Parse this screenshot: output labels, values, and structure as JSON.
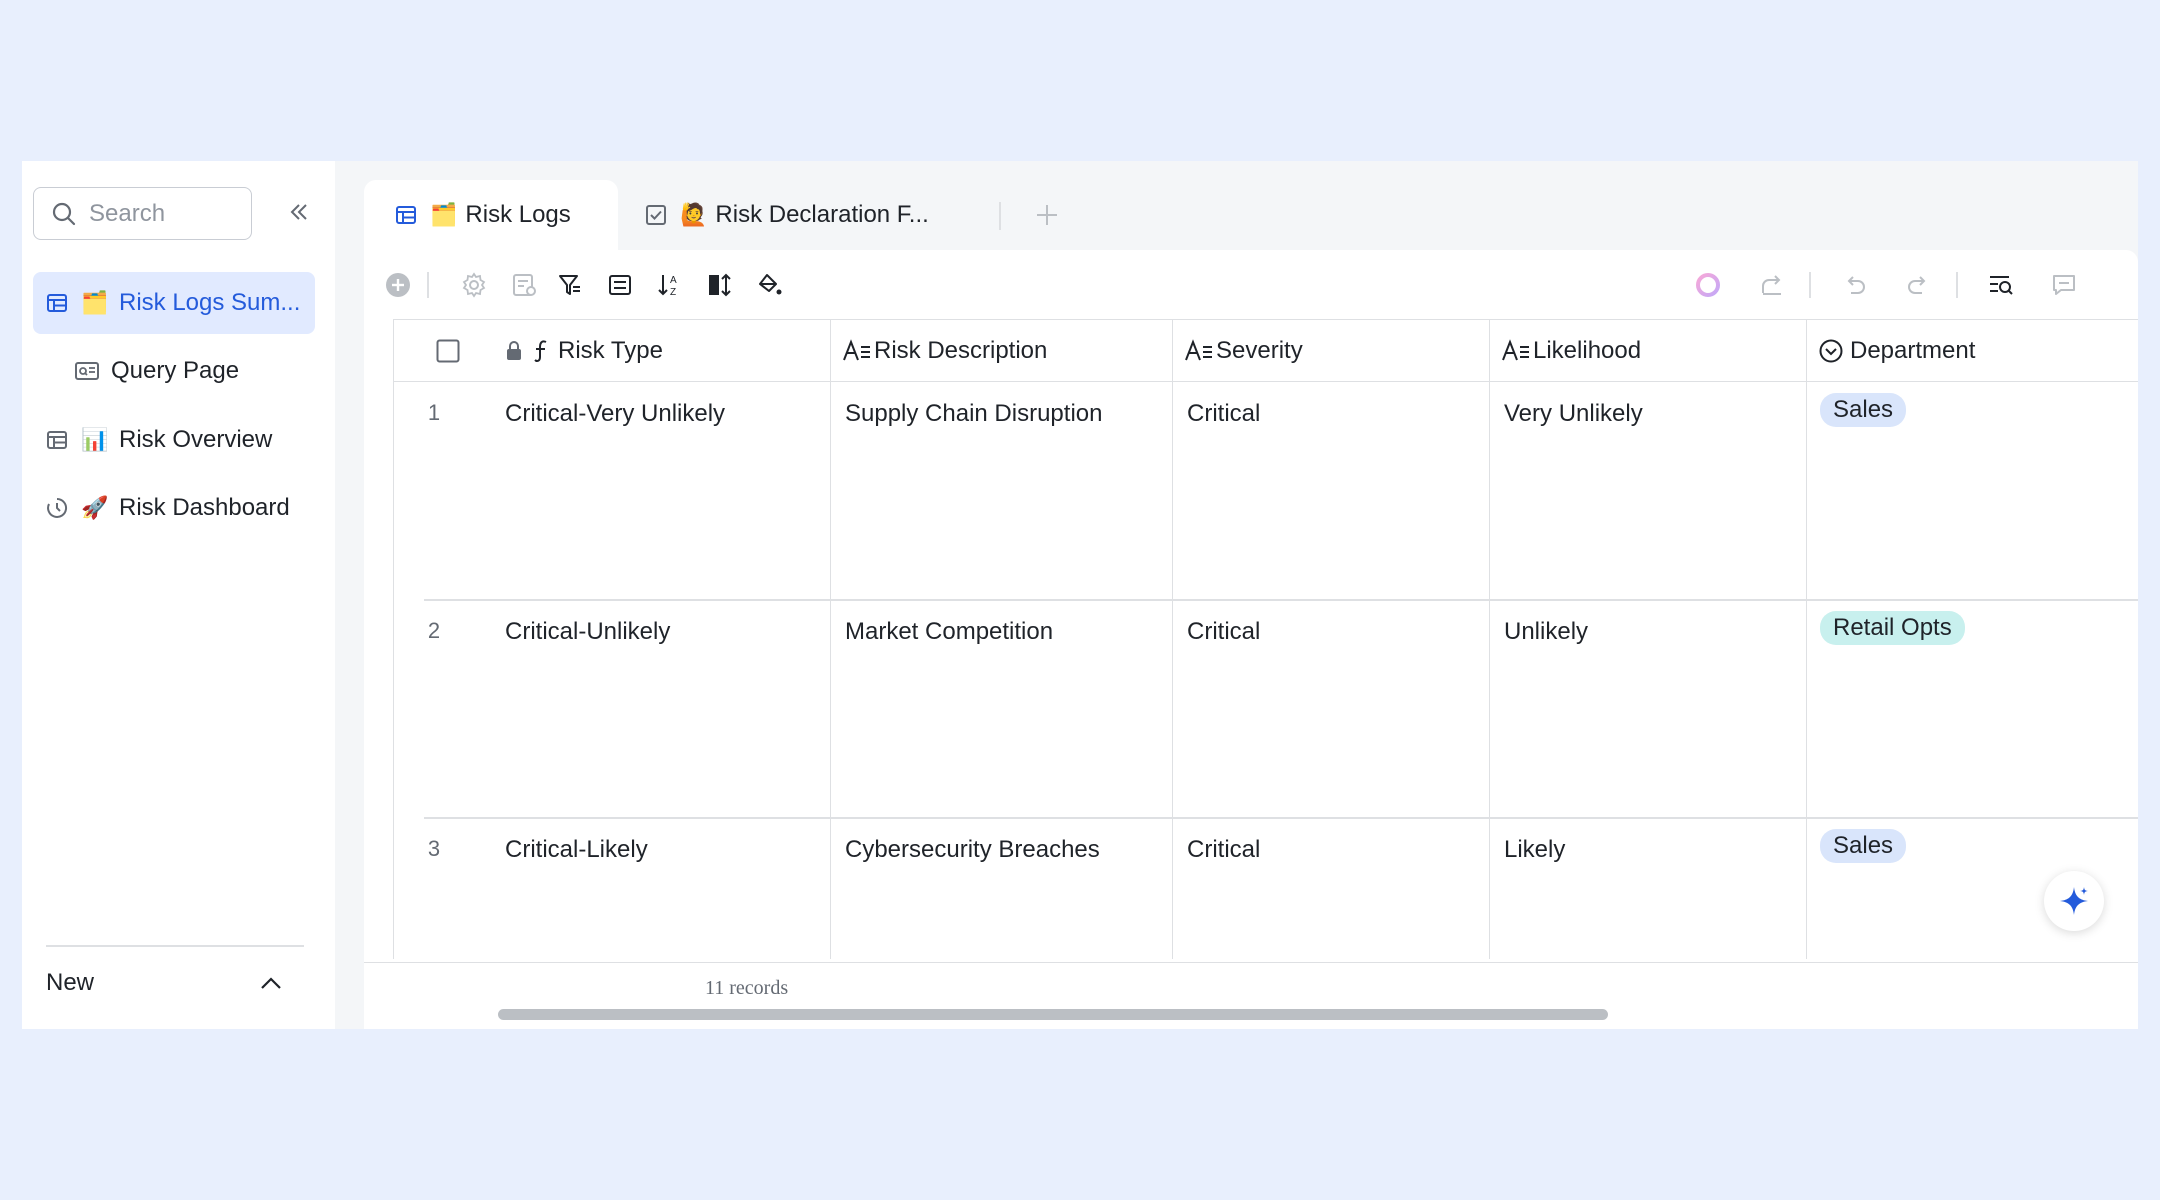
{
  "sidebar": {
    "search_placeholder": "Search",
    "items": [
      {
        "label": "Risk Logs Sum...",
        "emoji": "🗂️",
        "icon": "grid-icon",
        "active": true
      },
      {
        "label": "Query Page",
        "icon": "query-icon"
      },
      {
        "label": "Risk Overview",
        "emoji": "📊",
        "icon": "grid-icon"
      },
      {
        "label": "Risk Dashboard",
        "emoji": "🚀",
        "icon": "dashboard-icon"
      }
    ],
    "new_label": "New"
  },
  "tabs": [
    {
      "label": "Risk Logs",
      "emoji": "🗂️",
      "icon": "grid-icon",
      "active": true
    },
    {
      "label": "Risk Declaration F...",
      "emoji": "🙋",
      "icon": "form-icon"
    }
  ],
  "table": {
    "columns": [
      {
        "label": "Risk Type",
        "icon": "formula-icon",
        "locked": true
      },
      {
        "label": "Risk Description",
        "icon": "text-icon"
      },
      {
        "label": "Severity",
        "icon": "text-icon"
      },
      {
        "label": "Likelihood",
        "icon": "text-icon"
      },
      {
        "label": "Department",
        "icon": "single-select-icon"
      }
    ],
    "rows": [
      {
        "num": "1",
        "risk_type": "Critical-Very Unlikely",
        "description": "Supply Chain Disruption",
        "severity": "Critical",
        "likelihood": "Very Unlikely",
        "department": "Sales"
      },
      {
        "num": "2",
        "risk_type": "Critical-Unlikely",
        "description": "Market Competition",
        "severity": "Critical",
        "likelihood": "Unlikely",
        "department": "Retail Opts"
      },
      {
        "num": "3",
        "risk_type": "Critical-Likely",
        "description": "Cybersecurity Breaches",
        "severity": "Critical",
        "likelihood": "Likely",
        "department": "Sales"
      }
    ],
    "records_label": "11 records"
  },
  "colors": {
    "accent": "#245bdb",
    "active_bg": "#e1eaff",
    "tag_blue": "#d9e5fb",
    "tag_teal": "#c8f0ee"
  }
}
